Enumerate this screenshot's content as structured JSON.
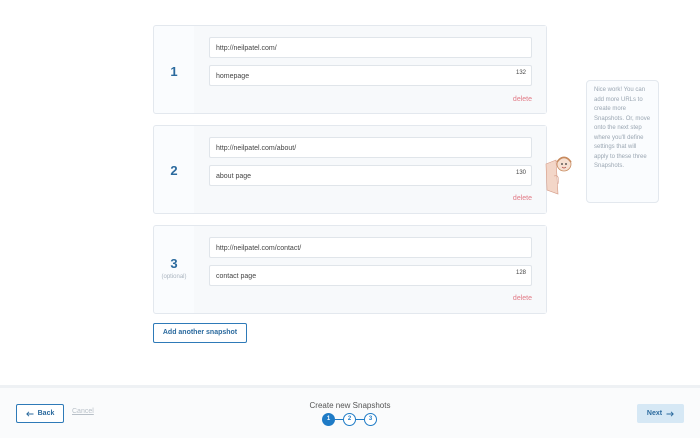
{
  "snapshots": [
    {
      "number": "1",
      "optional": "",
      "url": "http://neilpatel.com/",
      "name": "homepage",
      "count": "132",
      "delete": "delete"
    },
    {
      "number": "2",
      "optional": "",
      "url": "http://neilpatel.com/about/",
      "name": "about page",
      "count": "130",
      "delete": "delete"
    },
    {
      "number": "3",
      "optional": "(optional)",
      "url": "http://neilpatel.com/contact/",
      "name": "contact page",
      "count": "128",
      "delete": "delete"
    }
  ],
  "add_snapshot_label": "Add another snapshot",
  "tip_text": "Nice work! You can add more URLs to create more Snapshots. Or, move onto the next step where you'll define settings that will apply to these three Snapshots.",
  "footer": {
    "back_label": "Back",
    "cancel_label": "Cancel",
    "steps_title": "Create new Snapshots",
    "steps": [
      "1",
      "2",
      "3"
    ],
    "active_step": "1",
    "next_label": "Next"
  },
  "colors": {
    "accent": "#1f7bc6",
    "delete": "#e27a86",
    "next_bg": "#d6e8f5"
  },
  "icons": {
    "back": "arrow-left-icon",
    "next": "arrow-right-icon",
    "tip_character": "character-illustration"
  }
}
